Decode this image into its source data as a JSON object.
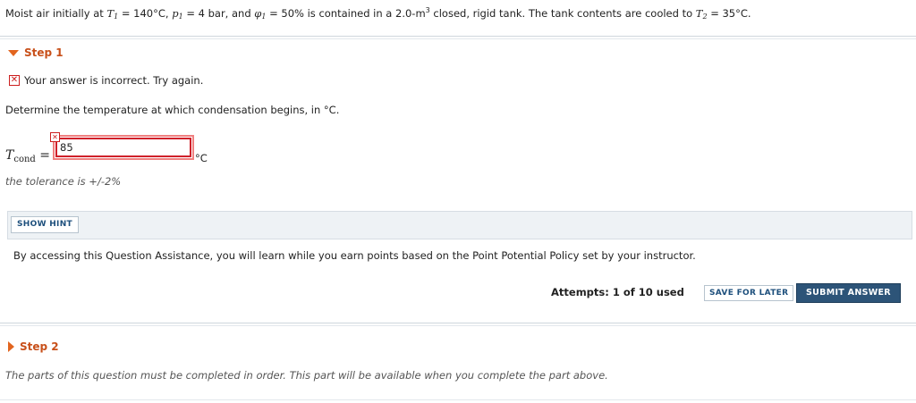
{
  "problem": {
    "text_1": "Moist air initially at ",
    "t1_sym": "T",
    "t1_sub": "1",
    "text_2": " = 140°C, ",
    "p1_sym": "p",
    "p1_sub": "1",
    "text_3": " = 4 bar, and ",
    "phi_sym": "φ",
    "phi_sub": "1",
    "text_4": " = 50% is contained in a 2.0-m",
    "cube": "3",
    "text_5": " closed, rigid tank. The tank contents are cooled to ",
    "t2_sym": "T",
    "t2_sub": "2",
    "text_6": " = 35°C."
  },
  "step1": {
    "title": "Step 1",
    "feedback": "Your answer is incorrect.  Try again.",
    "prompt": "Determine the temperature at which condensation begins, in °C.",
    "var_symbol": "T",
    "var_sub": "cond",
    "equals": "=",
    "answer_value": "85",
    "unit": "°C",
    "tolerance": "the tolerance is +/-2%",
    "show_hint_label": "SHOW HINT",
    "assistance_text": "By accessing this Question Assistance, you will learn while you earn points based on the Point Potential Policy set by your instructor.",
    "attempts": "Attempts: 1 of 10 used",
    "save_later_label": "SAVE FOR LATER",
    "submit_label": "SUBMIT ANSWER"
  },
  "step2": {
    "title": "Step 2",
    "message": "The parts of this question must be completed in order. This part will be available when you complete the part above."
  },
  "icons": {
    "step1_toggle": "triangle-down-icon",
    "step2_toggle": "triangle-right-icon",
    "error": "x-box-icon"
  },
  "colors": {
    "accent": "#e2651f",
    "error": "#cc1f1f",
    "submit_bg": "#2d5478",
    "link": "#1d4f7c"
  }
}
